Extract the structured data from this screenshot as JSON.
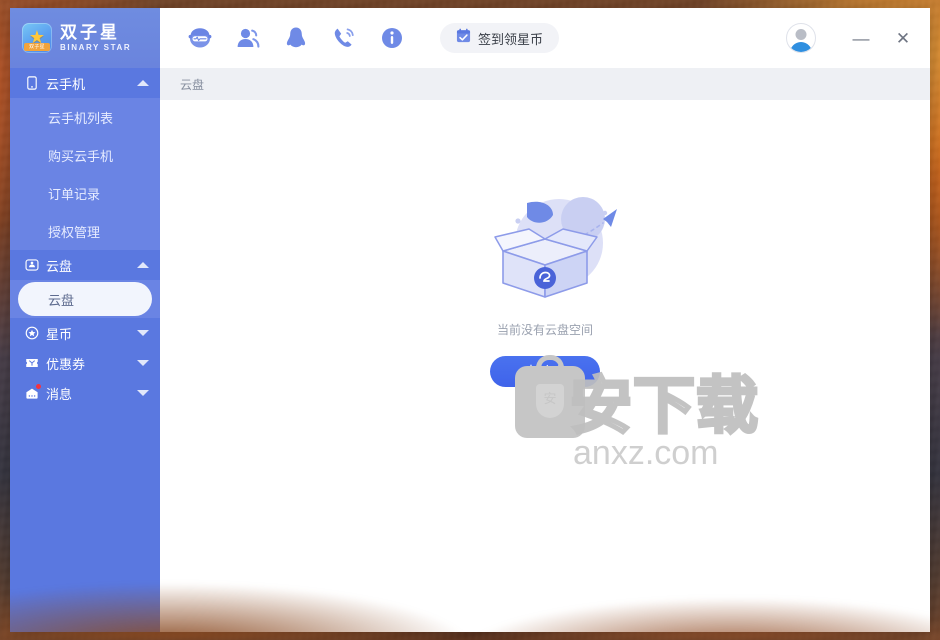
{
  "app": {
    "logo_cn": "双子星",
    "logo_en": "BINARY STAR",
    "logo_ribbon": "双子星"
  },
  "toolbar": {
    "icons": [
      {
        "name": "robot-assistant-icon",
        "title": "智能助手"
      },
      {
        "name": "contacts-icon",
        "title": "客服"
      },
      {
        "name": "qq-penguin-icon",
        "title": "QQ"
      },
      {
        "name": "phone-support-icon",
        "title": "电话"
      },
      {
        "name": "info-icon",
        "title": "关于"
      }
    ],
    "signin_label": "签到领星币",
    "signin_icon": "calendar-check-icon"
  },
  "window_controls": {
    "avatar_name": "user-avatar",
    "minimize": "—",
    "close": "✕"
  },
  "sidebar": {
    "groups": [
      {
        "label": "云手机",
        "icon": "phone-icon",
        "expanded": true,
        "caret": "up",
        "items": [
          {
            "label": "云手机列表",
            "selected": false
          },
          {
            "label": "购买云手机",
            "selected": false
          },
          {
            "label": "订单记录",
            "selected": false
          },
          {
            "label": "授权管理",
            "selected": false
          }
        ]
      },
      {
        "label": "云盘",
        "icon": "cloud-disk-icon",
        "expanded": true,
        "caret": "up",
        "items": [
          {
            "label": "云盘",
            "selected": true
          }
        ]
      },
      {
        "label": "星币",
        "icon": "coin-icon",
        "expanded": false,
        "caret": "down",
        "items": []
      },
      {
        "label": "优惠券",
        "icon": "coupon-icon",
        "expanded": false,
        "caret": "down",
        "items": []
      },
      {
        "label": "消息",
        "icon": "message-icon",
        "expanded": false,
        "caret": "down",
        "has_badge": true,
        "items": []
      }
    ]
  },
  "content": {
    "breadcrumb": "云盘",
    "empty_state": {
      "illustration": "empty-box-illustration",
      "message": "当前没有云盘空间",
      "action_label": "去扩容"
    }
  },
  "watermark": {
    "big": "安下载",
    "small": "anxz.com",
    "bag_letter": "安"
  },
  "colors": {
    "sidebar": "#5a78e0",
    "sidebar_child": "#6a84e4",
    "accent": "#4a72ef",
    "breadcrumb_bg": "#eef0f4",
    "badge": "#f5333f"
  }
}
